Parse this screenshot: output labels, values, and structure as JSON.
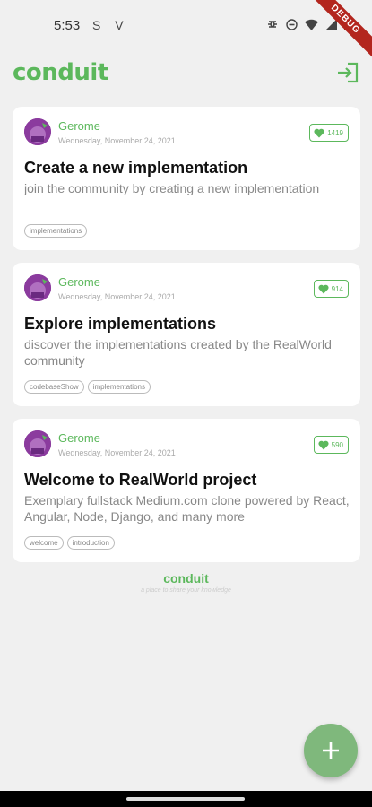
{
  "status_bar": {
    "time": "5:53",
    "left_icons": "S V"
  },
  "debug_banner": "DEBUG",
  "app": {
    "title": "conduit",
    "login_icon": "login-icon"
  },
  "articles": [
    {
      "author": "Gerome",
      "date": "Wednesday, November 24, 2021",
      "likes": "1419",
      "title": "Create a new implementation",
      "description": "join the community by creating a new implementation",
      "tags": [
        "implementations"
      ]
    },
    {
      "author": "Gerome",
      "date": "Wednesday, November 24, 2021",
      "likes": "914",
      "title": "Explore implementations",
      "description": "discover the implementations created by the RealWorld community",
      "tags": [
        "codebaseShow",
        "implementations"
      ]
    },
    {
      "author": "Gerome",
      "date": "Wednesday, November 24, 2021",
      "likes": "590",
      "title": "Welcome to RealWorld project",
      "description": "Exemplary fullstack Medium.com clone powered by React, Angular, Node, Django, and many more",
      "tags": [
        "welcome",
        "introduction"
      ]
    }
  ],
  "footer": {
    "title": "conduit",
    "subtitle": "a place to share your knowledge"
  },
  "fab_icon": "plus-icon",
  "colors": {
    "brand": "#5cb85c",
    "fab": "#7fb87c"
  }
}
